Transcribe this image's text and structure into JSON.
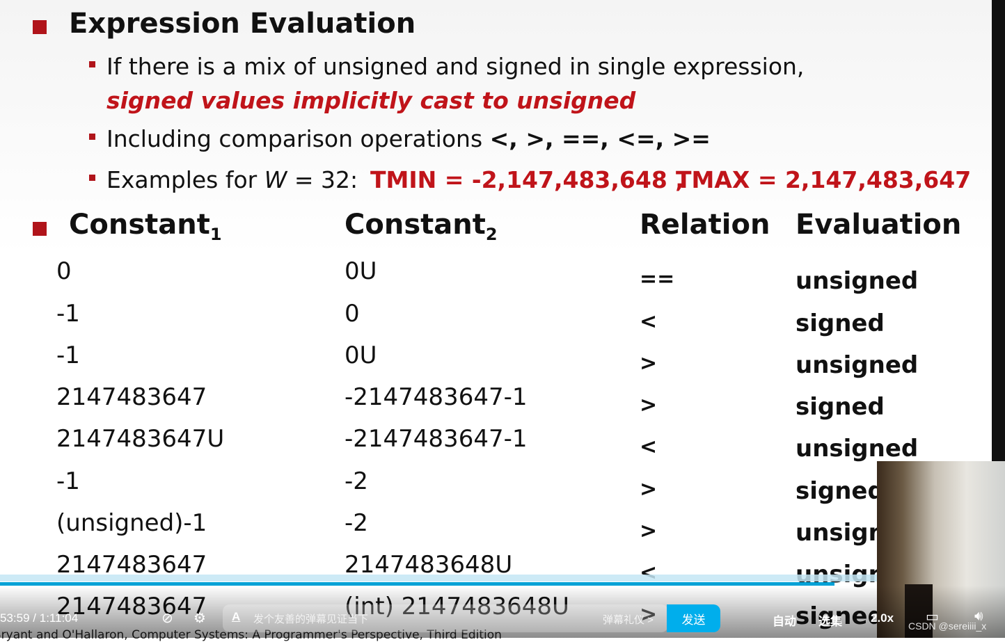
{
  "slide": {
    "title": "Expression Evaluation",
    "bullets": {
      "b1_line1": "If there is a mix of unsigned and signed in single expression,",
      "b1_line2": "signed values implicitly cast to unsigned",
      "b2_text": "Including comparison operations ",
      "b2_ops": "<, >, ==, <=, >=",
      "b3_prefix": "Examples for ",
      "b3_w": "W",
      "b3_eq": " = 32:",
      "tmin": "TMIN = -2,147,483,648 ,",
      "tmax": "TMAX = 2,147,483,647"
    },
    "table": {
      "headers": {
        "c1": "Constant",
        "c1_sub": "1",
        "c2": "Constant",
        "c2_sub": "2",
        "rel": "Relation",
        "eval": "Evaluation"
      },
      "rows": [
        {
          "c1": "0",
          "c2": "0U",
          "rel": "==",
          "eval": "unsigned"
        },
        {
          "c1": "-1",
          "c2": "0",
          "rel": "<",
          "eval": "signed"
        },
        {
          "c1": "-1",
          "c2": "0U",
          "rel": ">",
          "eval": "unsigned"
        },
        {
          "c1": "2147483647",
          "c2": "-2147483647-1",
          "rel": ">",
          "eval": "signed"
        },
        {
          "c1": "2147483647U",
          "c2": "-2147483647-1",
          "rel": "<",
          "eval": "unsigned"
        },
        {
          "c1": "-1",
          "c2": "-2",
          "rel": ">",
          "eval": "signed"
        },
        {
          "c1": "(unsigned)-1",
          "c2": "-2",
          "rel": ">",
          "eval": "unsigned"
        },
        {
          "c1": " 2147483647",
          "c2": "2147483648U",
          "rel": "<",
          "eval": "unsigned"
        },
        {
          "c1": " 2147483647",
          "c2": "(int) 2147483648U",
          "rel": ">",
          "eval": "signed"
        }
      ]
    },
    "footer": "Bryant and O'Hallaron, Computer Systems: A Programmer's Perspective, Third Edition",
    "accent": "#c0141a"
  },
  "player": {
    "time_current": "53:59",
    "time_sep": "/",
    "time_total": "1:11:04",
    "progress": 0.83,
    "danmu_placeholder": "发个友善的弹幕见证当下",
    "danmu_etiquette": "弹幕礼仪 >",
    "send_label": "发送",
    "auto_label": "自动",
    "episodes_label": "选集",
    "speed_label": "2.0x",
    "watermark": "CSDN @sereiiii_x",
    "accent": "#00aeec"
  }
}
